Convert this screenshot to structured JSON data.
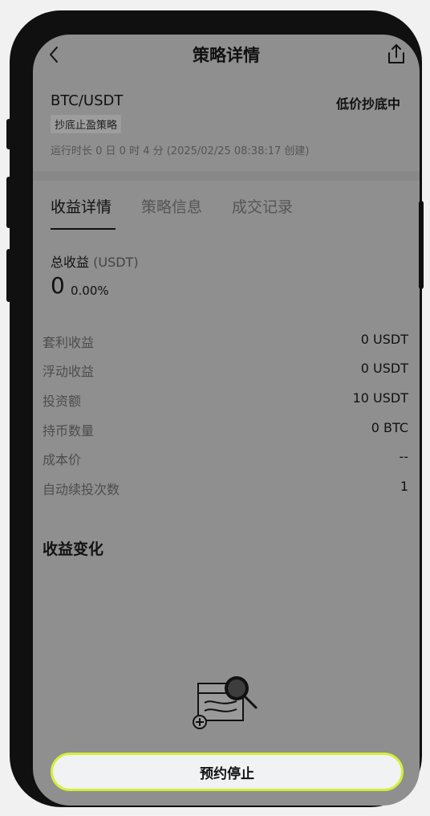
{
  "nav": {
    "title": "策略详情"
  },
  "strategy": {
    "pair": "BTC/USDT",
    "status": "低价抄底中",
    "tag": "抄底止盈策略",
    "runtime": "运行时长 0 日 0 时 4 分 (2025/02/25 08:38:17 创建)"
  },
  "tabs": [
    {
      "label": "收益详情",
      "active": true
    },
    {
      "label": "策略信息",
      "active": false
    },
    {
      "label": "成交记录",
      "active": false
    }
  ],
  "total": {
    "label": "总收益",
    "unit": "(USDT)",
    "value": "0",
    "percent": "0.00%"
  },
  "rows": [
    {
      "label": "套利收益",
      "value": "0 USDT"
    },
    {
      "label": "浮动收益",
      "value": "0 USDT"
    },
    {
      "label": "投资额",
      "value": "10 USDT"
    },
    {
      "label": "持币数量",
      "value": "0 BTC"
    },
    {
      "label": "成本价",
      "value": "--"
    },
    {
      "label": "自动续投次数",
      "value": "1"
    }
  ],
  "chart_section": {
    "title": "收益变化"
  },
  "cta": {
    "label": "预约停止"
  },
  "colors": {
    "accent_border": "#d5ef3a",
    "overlay": "#8f8f8f"
  },
  "icons": [
    "back-arrow-icon",
    "share-icon",
    "empty-data-illustration"
  ]
}
